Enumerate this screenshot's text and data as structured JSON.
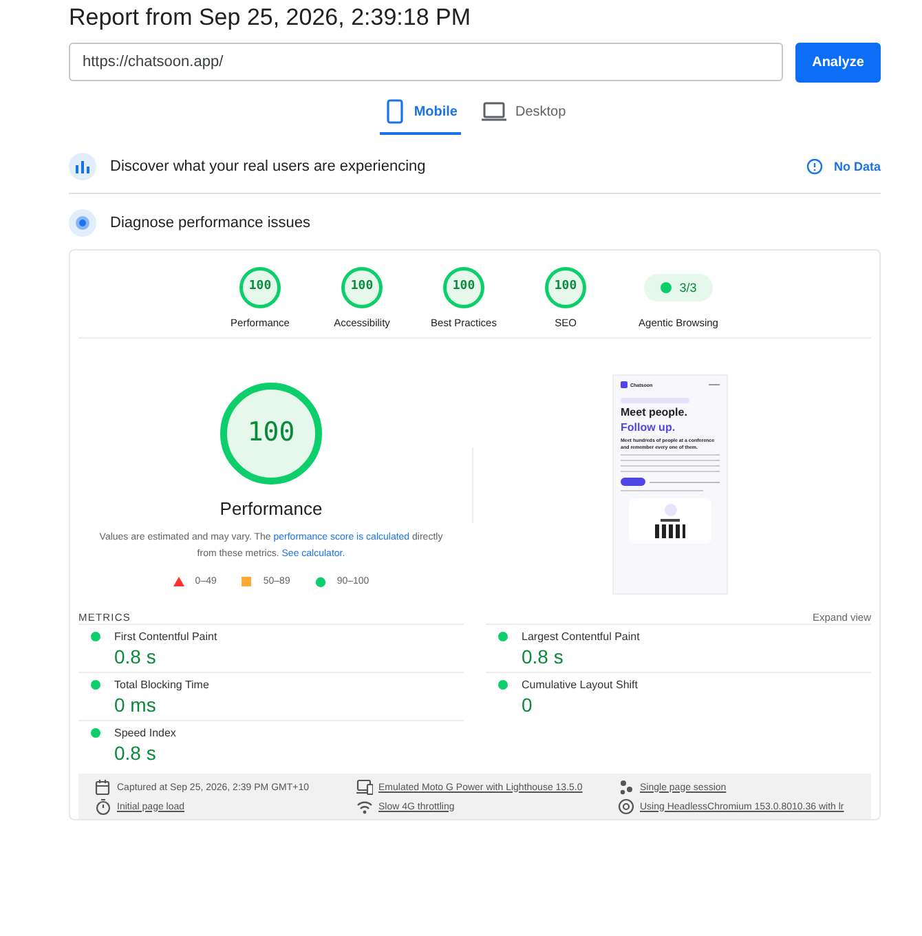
{
  "report_title": "Report from Sep 25, 2026, 2:39:18 PM",
  "url_field": {
    "value": "https://chatsoon.app/"
  },
  "analyze_button": "Analyze",
  "tabs": [
    {
      "label": "Mobile",
      "kind": "mobile",
      "selected": true
    },
    {
      "label": "Desktop",
      "kind": "desktop",
      "selected": false
    }
  ],
  "field_data": {
    "title": "Discover what your real users are experiencing",
    "status": "No Data"
  },
  "lab_data": {
    "title": "Diagnose performance issues"
  },
  "categories": [
    {
      "label": "Performance",
      "score": "100",
      "kind": "gauge"
    },
    {
      "label": "Accessibility",
      "score": "100",
      "kind": "gauge"
    },
    {
      "label": "Best Practices",
      "score": "100",
      "kind": "gauge"
    },
    {
      "label": "SEO",
      "score": "100",
      "kind": "gauge"
    },
    {
      "label": "Agentic Browsing",
      "score": "3/3",
      "kind": "pill"
    }
  ],
  "main_gauge": {
    "score": "100",
    "label": "Performance"
  },
  "note": [
    {
      "text": "Values are estimated and may vary. The ",
      "kind": "text"
    },
    {
      "text": "performance score is calculated",
      "kind": "link"
    },
    {
      "text": " directly from these metrics. ",
      "kind": "text"
    },
    {
      "text": "See calculator.",
      "kind": "link"
    }
  ],
  "legend": [
    {
      "range": "0–49",
      "kind": "fail"
    },
    {
      "range": "50–89",
      "kind": "average"
    },
    {
      "range": "90–100",
      "kind": "pass"
    }
  ],
  "screenshot": {
    "brand": "Chatsoon",
    "headline": "Meet people.",
    "headline_accent": "Follow up.",
    "lead": "Meet hundreds of people at a conference and remember every one of them."
  },
  "metrics": {
    "heading": "METRICS",
    "toggle": "Expand view",
    "items": [
      {
        "name": "First Contentful Paint",
        "value": "0.8 s"
      },
      {
        "name": "Largest Contentful Paint",
        "value": "0.8 s"
      },
      {
        "name": "Total Blocking Time",
        "value": "0 ms"
      },
      {
        "name": "Cumulative Layout Shift",
        "value": "0"
      },
      {
        "name": "Speed Index",
        "value": "0.8 s"
      }
    ]
  },
  "footer": [
    {
      "text": "Captured at Sep 25, 2026, 2:39 PM GMT+10",
      "kind": "calendar",
      "link": false
    },
    {
      "text": "Emulated Moto G Power with Lighthouse 13.5.0",
      "kind": "device",
      "link": true
    },
    {
      "text": "Single page session",
      "kind": "people",
      "link": true
    },
    {
      "text": "Initial page load",
      "kind": "timer",
      "link": true
    },
    {
      "text": "Slow 4G throttling",
      "kind": "wifi",
      "link": true
    },
    {
      "text": "Using HeadlessChromium 153.0.8010.36 with lr",
      "kind": "browser",
      "link": true
    }
  ]
}
